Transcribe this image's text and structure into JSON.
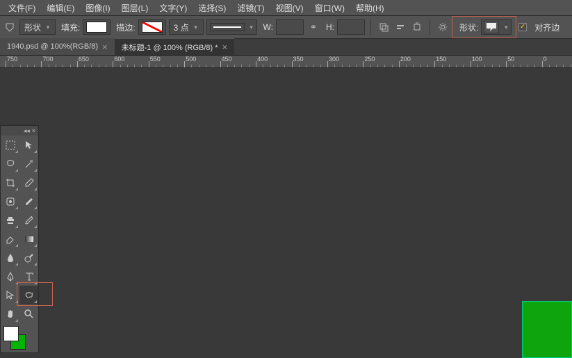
{
  "menubar": {
    "items": [
      "文件(F)",
      "编辑(E)",
      "图像(I)",
      "图层(L)",
      "文字(Y)",
      "选择(S)",
      "滤镜(T)",
      "视图(V)",
      "窗口(W)",
      "帮助(H)"
    ]
  },
  "optionsbar": {
    "shape_mode": "形状",
    "fill_label": "填充:",
    "stroke_label": "描边:",
    "stroke_width": "3 点",
    "w_label": "W:",
    "w_value": "",
    "h_label": "H:",
    "h_value": "",
    "shape_label": "形状:",
    "align_label": "对齐边"
  },
  "tabs": [
    {
      "title": "1940.psd @ 100%(RGB/8)",
      "active": false
    },
    {
      "title": "未标题-1 @ 100% (RGB/8) *",
      "active": true
    }
  ],
  "ruler": {
    "ticks": [
      750,
      700,
      650,
      600,
      550,
      500,
      450,
      400,
      350,
      300,
      250,
      200,
      150,
      100,
      50,
      0
    ]
  },
  "tools": {
    "rows": [
      [
        "marquee",
        "move"
      ],
      [
        "lasso",
        "wand"
      ],
      [
        "crop",
        "eyedropper"
      ],
      [
        "healing",
        "brush"
      ],
      [
        "stamp",
        "history"
      ],
      [
        "eraser",
        "gradient"
      ],
      [
        "blur",
        "dodge"
      ],
      [
        "pen",
        "type"
      ],
      [
        "path-select",
        "custom-shape"
      ],
      [
        "hand",
        "zoom"
      ]
    ],
    "fg_color": "#ffffff",
    "bg_color": "#00b400"
  }
}
